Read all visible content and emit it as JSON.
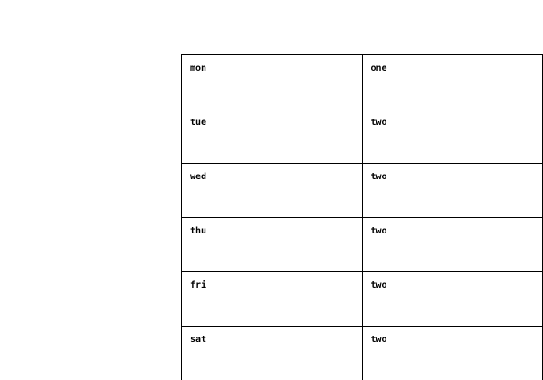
{
  "table": {
    "rows": [
      {
        "day": "mon",
        "value": "one"
      },
      {
        "day": "tue",
        "value": "two"
      },
      {
        "day": "wed",
        "value": "two"
      },
      {
        "day": "thu",
        "value": "two"
      },
      {
        "day": "fri",
        "value": "two"
      },
      {
        "day": "sat",
        "value": "two"
      }
    ]
  },
  "colors": {
    "background": "#ffffff",
    "border": "#000000",
    "text": "#000000"
  }
}
